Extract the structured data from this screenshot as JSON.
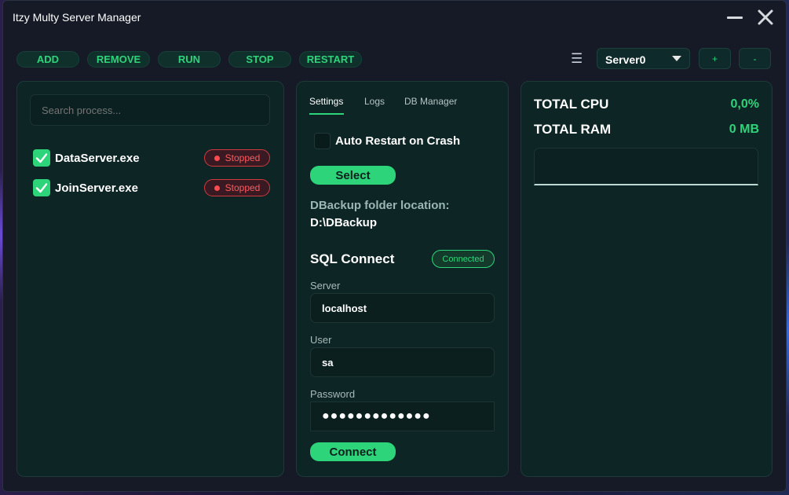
{
  "window": {
    "title": "Itzy Multy Server Manager"
  },
  "toolbar": {
    "buttons": [
      "ADD",
      "REMOVE",
      "RUN",
      "STOP",
      "RESTART"
    ],
    "server_select": "Server0",
    "plus": "+",
    "minus": "-"
  },
  "processes": {
    "search_placeholder": "Search process...",
    "items": [
      {
        "name": "DataServer.exe",
        "checked": true,
        "status": "Stopped"
      },
      {
        "name": "JoinServer.exe",
        "checked": true,
        "status": "Stopped"
      }
    ]
  },
  "settings": {
    "tabs": [
      "Settings",
      "Logs",
      "DB Manager"
    ],
    "active_tab": "Settings",
    "auto_restart_label": "Auto Restart on Crash",
    "auto_restart_checked": false,
    "select_label": "Select",
    "dbackup_label": "DBackup folder location:",
    "dbackup_value": "D:\\DBackup",
    "sql_title": "SQL Connect",
    "sql_status": "Connected",
    "server_label": "Server",
    "server_value": "localhost",
    "user_label": "User",
    "user_value": "sa",
    "password_label": "Password",
    "password_value": "●●●●●●●●●●●●●",
    "connect_label": "Connect"
  },
  "stats": {
    "cpu_label": "TOTAL CPU",
    "cpu_value": "0,0%",
    "ram_label": "TOTAL RAM",
    "ram_value": "0 MB"
  },
  "colors": {
    "accent": "#2ed47a",
    "panel": "#0d2525",
    "window": "#151a26",
    "danger": "#ff4b4f"
  }
}
